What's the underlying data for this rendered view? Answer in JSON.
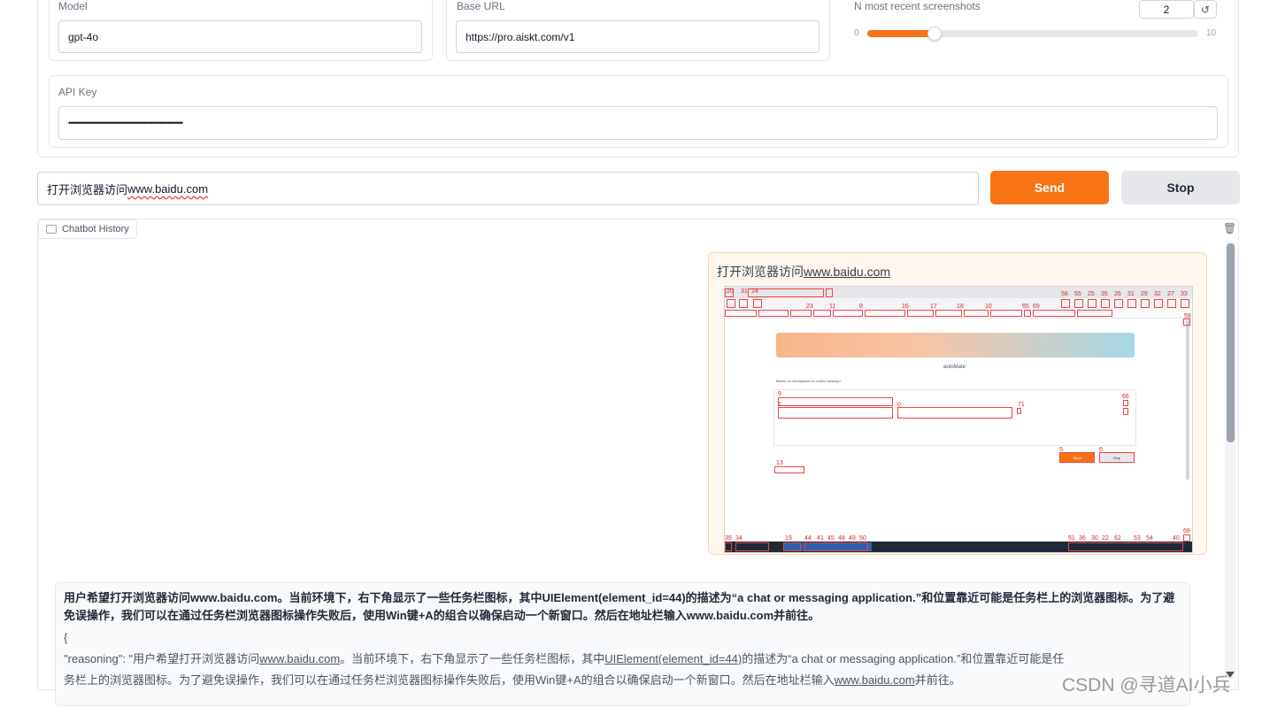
{
  "settings": {
    "model_label": "Model",
    "model_value": "gpt-4o",
    "base_url_label": "Base URL",
    "base_url_value": "https://pro.aiskt.com/v1",
    "screenshots_label": "N most recent screenshots",
    "screenshots_value": "2",
    "screenshots_min": "0",
    "screenshots_max": "10",
    "screenshots_fraction": 0.2,
    "reset_icon": "↺",
    "api_key_label": "API Key",
    "api_key_value": "••••••••••••••••••••••••••••••••••••••••••••••••••••••••••••"
  },
  "chat_input": {
    "value_prefix": "打开浏览器访问",
    "value_link": "www.baidu.com"
  },
  "buttons": {
    "send": "Send",
    "stop": "Stop"
  },
  "history": {
    "tab_label": "Chatbot History",
    "trash_icon": "🗑",
    "user_message_prefix": "打开浏览器访问",
    "user_message_link": "www.baidu.com",
    "screenshot": {
      "app_title": "autoMate",
      "app_subtitle": "Based on Omniparser to control desktop!",
      "send": "Send",
      "stop": "Stop"
    },
    "bot_summary": "用户希望打开浏览器访问www.baidu.com。当前环境下，右下角显示了一些任务栏图标，其中UIElement(element_id=44)的描述为“a chat or messaging application.”和位置靠近可能是任务栏上的浏览器图标。为了避免误操作，我们可以在通过任务栏浏览器图标操作失败后，使用Win键+A的组合以确保启动一个新窗口。然后在地址栏输入www.baidu.com并前往。",
    "bot_json_open": "{",
    "bot_json_line1_pre": "\"reasoning\": \"用户希望打开浏览器访问",
    "bot_json_line1_link": "www.baidu.com",
    "bot_json_line1_mid": "。当前环境下，右下角显示了一些任务栏图标，其中",
    "bot_json_line1_link2": "UIElement(element_id=44)",
    "bot_json_line1_post": "的描述为“a chat or messaging application.”和位置靠近可能是任",
    "bot_json_line2_pre": "务栏上的浏览器图标。为了避免误操作，我们可以在通过任务栏浏览器图标操作失败后，使用Win键+A的组合以确保启动一个新窗口。然后在地址栏输入",
    "bot_json_line2_link": "www.baidu.com",
    "bot_json_line2_post": "并前往。"
  },
  "watermark": "CSDN @寻道AI小兵",
  "colors": {
    "accent": "#f97316",
    "stop_bg": "#e5e7eb",
    "user_bubble_bg": "#fff7ed",
    "user_bubble_border": "#fed7aa"
  }
}
